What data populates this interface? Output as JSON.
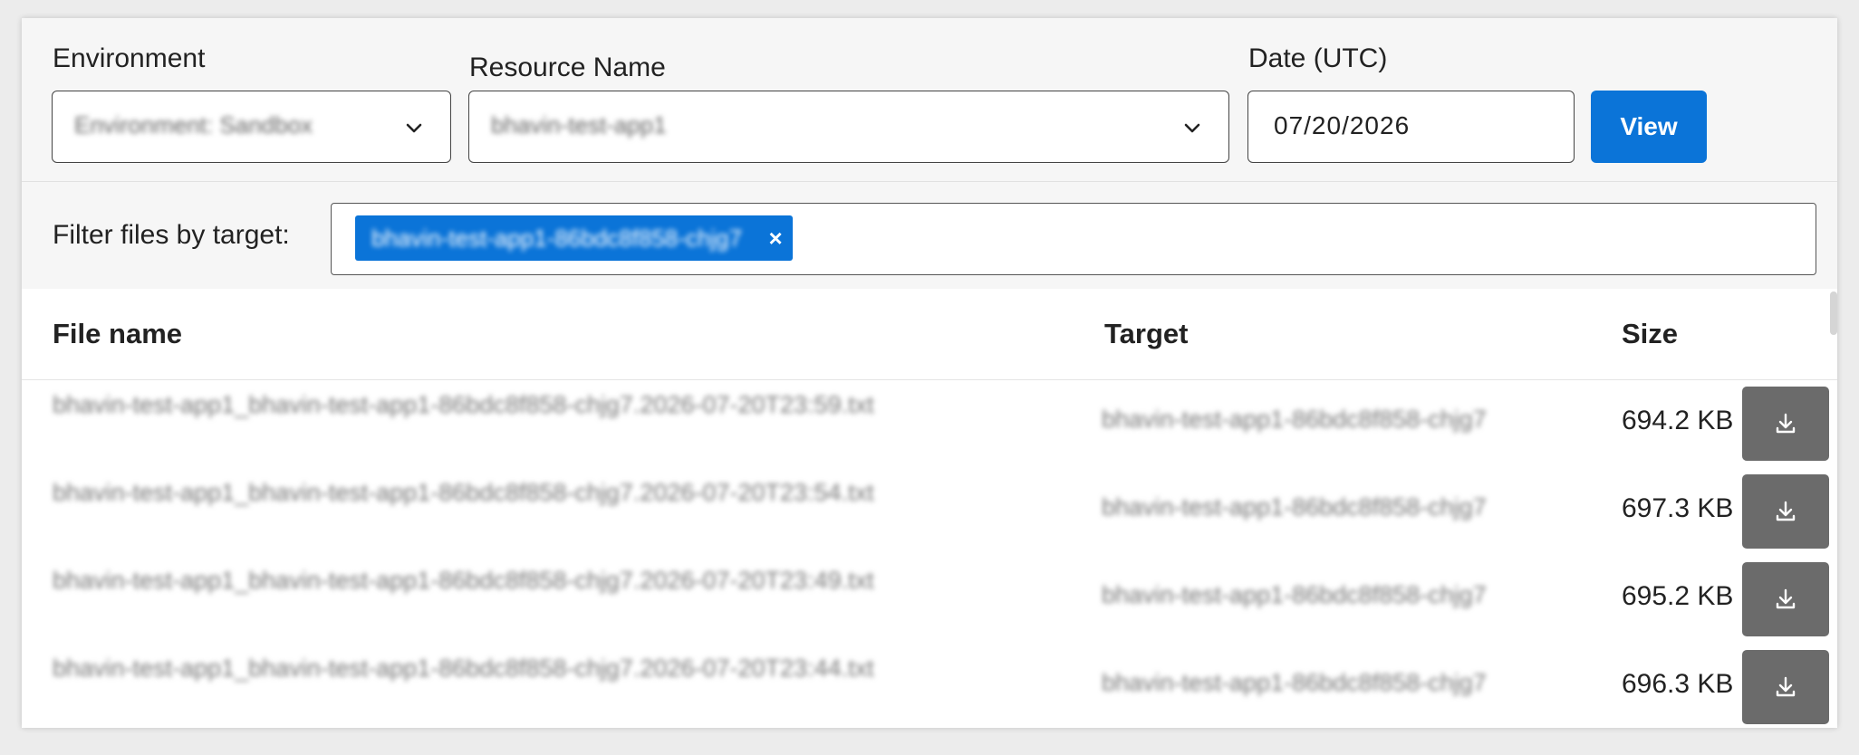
{
  "controls": {
    "environment": {
      "label": "Environment",
      "value": "Environment: Sandbox"
    },
    "resource": {
      "label": "Resource Name",
      "value": "bhavin-test-app1"
    },
    "date": {
      "label": "Date (UTC)",
      "value": "07/20/2026"
    },
    "view_label": "View"
  },
  "filter": {
    "label": "Filter files by target:",
    "chip": "bhavin-test-app1-86bdc8f858-chjg7",
    "chip_close": "×"
  },
  "table": {
    "headers": {
      "name": "File name",
      "target": "Target",
      "size": "Size"
    },
    "rows": [
      {
        "name": "bhavin-test-app1_bhavin-test-app1-86bdc8f858-chjg7.2026-07-20T23:59.txt",
        "target": "bhavin-test-app1-86bdc8f858-chjg7",
        "size": "694.2 KB"
      },
      {
        "name": "bhavin-test-app1_bhavin-test-app1-86bdc8f858-chjg7.2026-07-20T23:54.txt",
        "target": "bhavin-test-app1-86bdc8f858-chjg7",
        "size": "697.3 KB"
      },
      {
        "name": "bhavin-test-app1_bhavin-test-app1-86bdc8f858-chjg7.2026-07-20T23:49.txt",
        "target": "bhavin-test-app1-86bdc8f858-chjg7",
        "size": "695.2 KB"
      },
      {
        "name": "bhavin-test-app1_bhavin-test-app1-86bdc8f858-chjg7.2026-07-20T23:44.txt",
        "target": "bhavin-test-app1-86bdc8f858-chjg7",
        "size": "696.3 KB"
      }
    ]
  },
  "icons": {
    "chevron": "chevron-down-icon",
    "download": "download-icon"
  },
  "colors": {
    "accent": "#0b74d8",
    "download_button": "#6b6b6b"
  }
}
